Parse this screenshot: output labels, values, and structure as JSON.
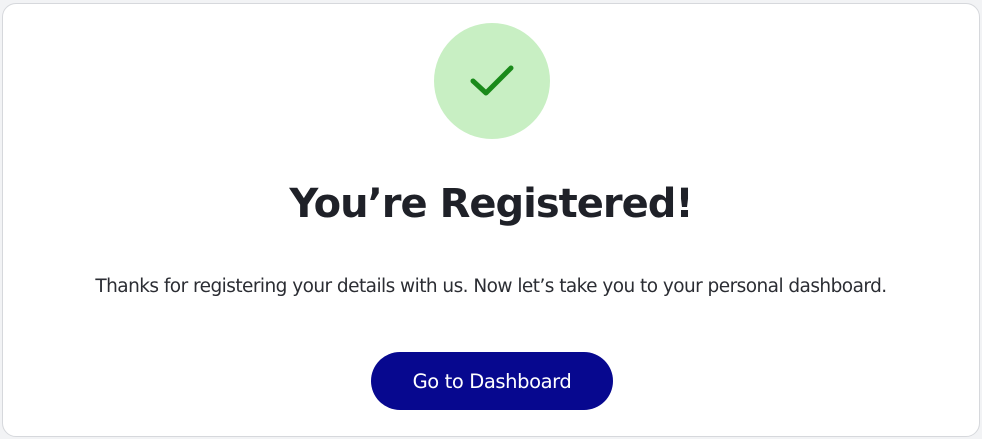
{
  "registration": {
    "title": "You’re Registered!",
    "message": "Thanks for registering your details with us. Now let’s take you to your personal dashboard.",
    "cta_label": "Go to Dashboard",
    "status_icon": "checkmark-icon"
  },
  "colors": {
    "success_circle": "#c8efc3",
    "checkmark": "#1a8a1a",
    "button_background": "#07088f",
    "button_text": "#ffffff",
    "title_text": "#1f2128",
    "body_text": "#2b2d33"
  }
}
